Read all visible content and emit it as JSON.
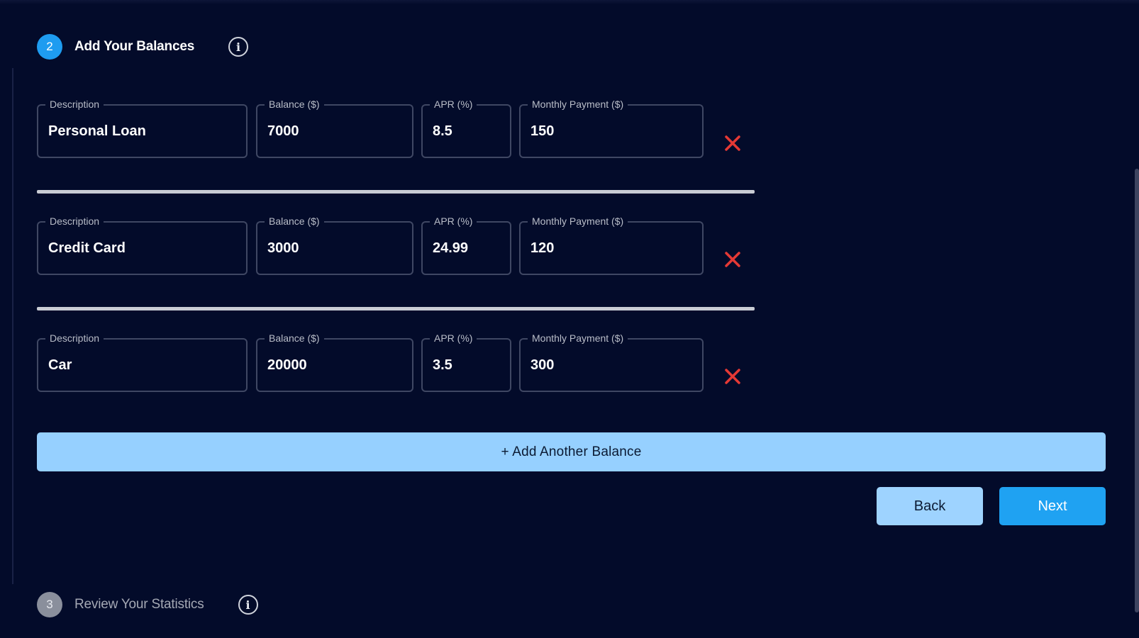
{
  "step2": {
    "number": "2",
    "title": "Add Your Balances",
    "info_icon": "info-icon"
  },
  "step3": {
    "number": "3",
    "title": "Review Your Statistics",
    "info_icon": "info-icon"
  },
  "labels": {
    "description": "Description",
    "balance": "Balance ($)",
    "apr": "APR (%)",
    "monthly": "Monthly Payment ($)"
  },
  "balances": [
    {
      "description": "Personal Loan",
      "balance": "7000",
      "apr": "8.5",
      "monthly": "150"
    },
    {
      "description": "Credit Card",
      "balance": "3000",
      "apr": "24.99",
      "monthly": "120"
    },
    {
      "description": "Car",
      "balance": "20000",
      "apr": "3.5",
      "monthly": "300"
    }
  ],
  "buttons": {
    "add_balance": "+ Add Another Balance",
    "back": "Back",
    "next": "Next"
  },
  "colors": {
    "background": "#030b2a",
    "accent": "#1e9cf0",
    "remove": "#e53935",
    "add_button": "#96d0ff"
  }
}
